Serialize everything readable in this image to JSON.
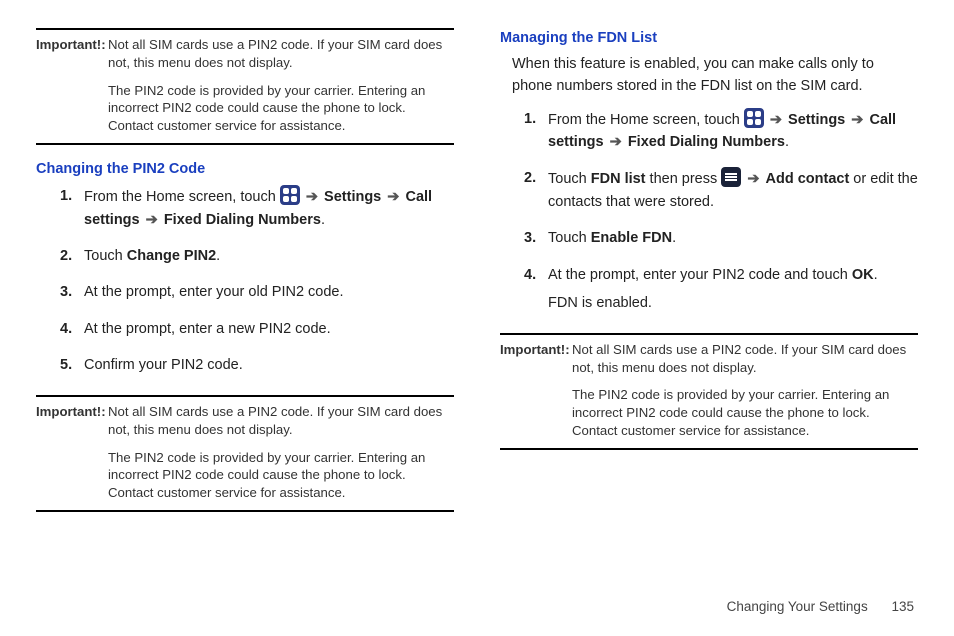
{
  "important": {
    "label": "Important!:",
    "p1": "Not all SIM cards use a PIN2 code. If your SIM card does not, this menu does not display.",
    "p2": "The PIN2 code is provided by your carrier. Entering an incorrect PIN2 code could cause the phone to lock. Contact customer service for assistance."
  },
  "left": {
    "heading": "Changing the PIN2 Code",
    "steps": {
      "s1a": "From the Home screen, touch ",
      "s1b": "Settings",
      "s1c": "Call settings",
      "s1d": "Fixed Dialing Numbers",
      "s2a": "Touch ",
      "s2b": "Change PIN2",
      "s3": "At the prompt, enter your old PIN2 code.",
      "s4": "At the prompt, enter a new PIN2 code.",
      "s5": "Confirm your PIN2 code."
    }
  },
  "right": {
    "heading": "Managing the FDN List",
    "intro": "When this feature is enabled, you can make calls only to phone numbers stored in the FDN list on the SIM card.",
    "steps": {
      "s1a": "From the Home screen, touch ",
      "s1b": "Settings",
      "s1c": "Call settings",
      "s1d": "Fixed Dialing Numbers",
      "s2a": "Touch ",
      "s2b": "FDN list",
      "s2c": " then press ",
      "s2d": "Add contact",
      "s2e": " or edit the contacts that were stored.",
      "s3a": "Touch ",
      "s3b": "Enable FDN",
      "s4a": "At the prompt, enter your PIN2 code and touch ",
      "s4b": "OK",
      "s4c": "FDN is enabled."
    }
  },
  "arrow": "➔",
  "period": ".",
  "footer": {
    "section": "Changing Your Settings",
    "page": "135"
  }
}
